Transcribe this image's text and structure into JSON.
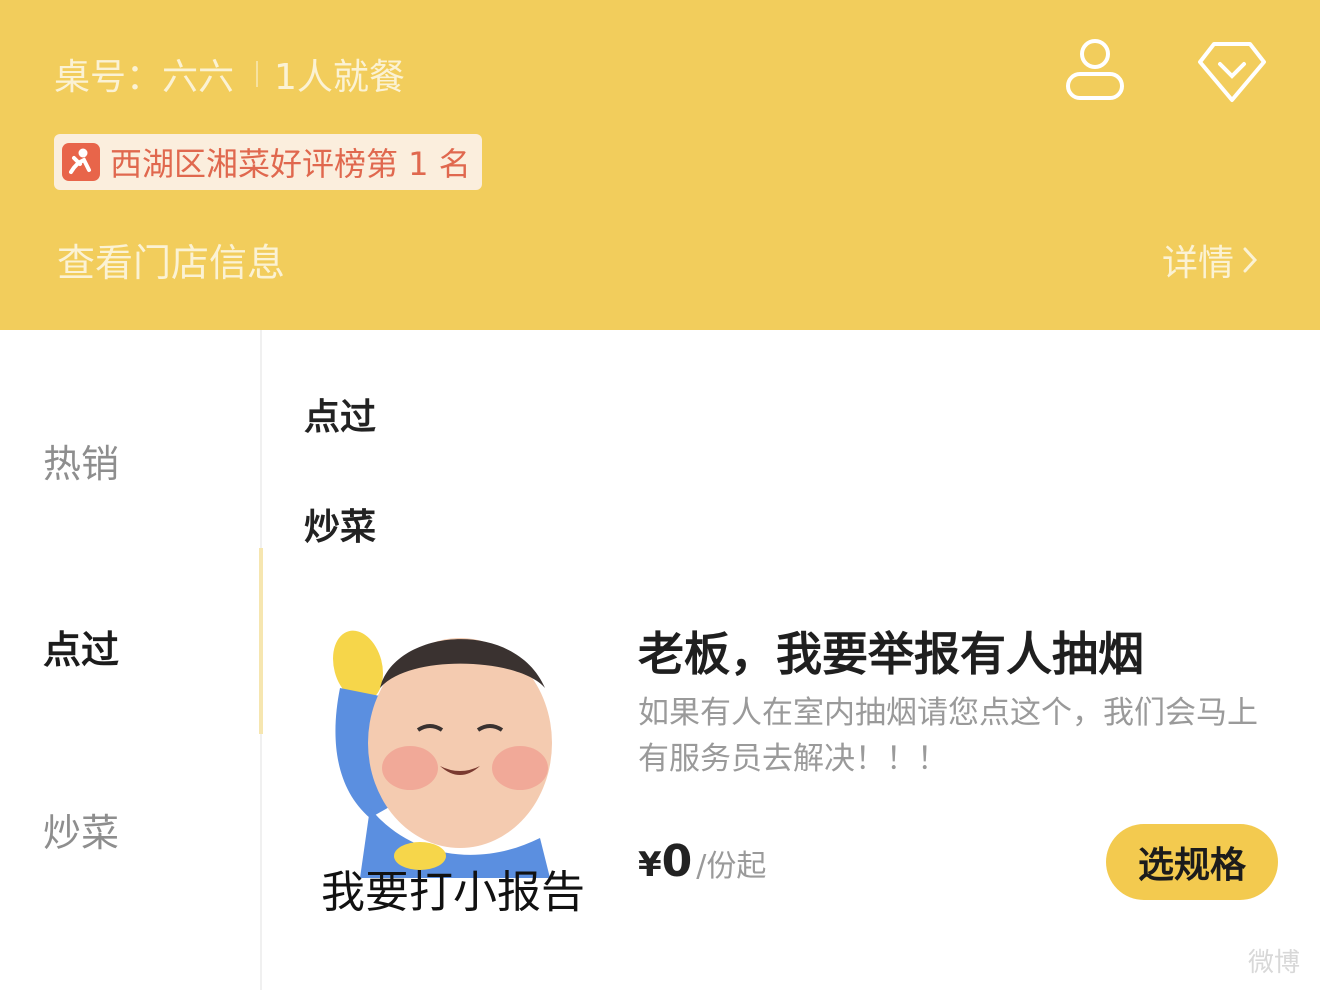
{
  "header": {
    "table_label": "桌号：六六",
    "diners": "1人就餐",
    "rank_badge": "西湖区湘菜好评榜第 1 名",
    "store_info": "查看门店信息",
    "detail_link": "详情",
    "user_icon": "user-icon",
    "vip_icon": "diamond-icon",
    "color": "#f2cd5c"
  },
  "sidebar": {
    "items": [
      {
        "label": "热销"
      },
      {
        "label": "点过",
        "active": true
      },
      {
        "label": "炒菜"
      }
    ]
  },
  "main": {
    "sections": [
      {
        "title": "点过"
      },
      {
        "title": "炒菜"
      }
    ],
    "product": {
      "image_caption": "我要打小报告",
      "name": "老板，我要举报有人抽烟",
      "desc": "如果有人在室内抽烟请您点这个，我们会马上有服务员去解决！！！",
      "price_symbol": "¥",
      "price": "0",
      "price_unit": "/份起",
      "button_label": "选规格"
    }
  },
  "watermark": "微博"
}
